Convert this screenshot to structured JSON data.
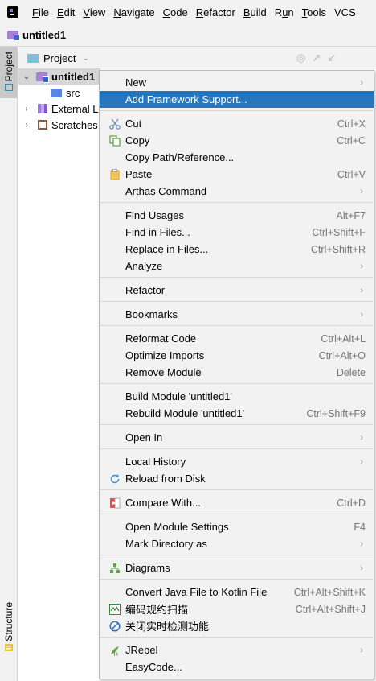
{
  "menubar": {
    "items": [
      {
        "pre": "",
        "ul": "F",
        "post": "ile"
      },
      {
        "pre": "",
        "ul": "E",
        "post": "dit"
      },
      {
        "pre": "",
        "ul": "V",
        "post": "iew"
      },
      {
        "pre": "",
        "ul": "N",
        "post": "avigate"
      },
      {
        "pre": "",
        "ul": "C",
        "post": "ode"
      },
      {
        "pre": "",
        "ul": "R",
        "post": "efactor"
      },
      {
        "pre": "",
        "ul": "B",
        "post": "uild"
      },
      {
        "pre": "R",
        "ul": "u",
        "post": "n"
      },
      {
        "pre": "",
        "ul": "T",
        "post": "ools"
      },
      {
        "pre": "",
        "ul": "",
        "post": "VCS"
      }
    ]
  },
  "navbar": {
    "project_name": "untitled1"
  },
  "tool_strip": {
    "project_tab": "Project",
    "structure_tab": "Structure"
  },
  "panel": {
    "header_title": "Project",
    "tree": {
      "root": "untitled1",
      "src": "src",
      "external_libs": "External Li",
      "scratches": "Scratches"
    }
  },
  "context_menu": {
    "items": [
      {
        "label": "New",
        "shortcut": "",
        "submenu": true
      },
      {
        "label": "Add Framework Support...",
        "shortcut": "",
        "submenu": false,
        "highlighted": true
      },
      {
        "label": "Cut",
        "shortcut": "Ctrl+X",
        "icon": "scissors-icon"
      },
      {
        "label": "Copy",
        "shortcut": "Ctrl+C",
        "icon": "copy-icon"
      },
      {
        "label": "Copy Path/Reference...",
        "shortcut": ""
      },
      {
        "label": "Paste",
        "shortcut": "Ctrl+V",
        "icon": "clipboard-icon"
      },
      {
        "label": "Arthas Command",
        "shortcut": "",
        "submenu": true
      },
      {
        "label": "Find Usages",
        "shortcut": "Alt+F7"
      },
      {
        "label": "Find in Files...",
        "shortcut": "Ctrl+Shift+F"
      },
      {
        "label": "Replace in Files...",
        "shortcut": "Ctrl+Shift+R"
      },
      {
        "label": "Analyze",
        "shortcut": "",
        "submenu": true
      },
      {
        "label": "Refactor",
        "shortcut": "",
        "submenu": true
      },
      {
        "label": "Bookmarks",
        "shortcut": "",
        "submenu": true
      },
      {
        "label": "Reformat Code",
        "shortcut": "Ctrl+Alt+L"
      },
      {
        "label": "Optimize Imports",
        "shortcut": "Ctrl+Alt+O"
      },
      {
        "label": "Remove Module",
        "shortcut": "Delete"
      },
      {
        "label": "Build Module 'untitled1'",
        "shortcut": ""
      },
      {
        "label": "Rebuild Module 'untitled1'",
        "shortcut": "Ctrl+Shift+F9"
      },
      {
        "label": "Open In",
        "shortcut": "",
        "submenu": true
      },
      {
        "label": "Local History",
        "shortcut": "",
        "submenu": true
      },
      {
        "label": "Reload from Disk",
        "shortcut": "",
        "icon": "reload-icon"
      },
      {
        "label": "Compare With...",
        "shortcut": "Ctrl+D",
        "icon": "compare-icon"
      },
      {
        "label": "Open Module Settings",
        "shortcut": "F4"
      },
      {
        "label": "Mark Directory as",
        "shortcut": "",
        "submenu": true
      },
      {
        "label": "Diagrams",
        "shortcut": "",
        "submenu": true,
        "icon": "diagram-icon"
      },
      {
        "label": "Convert Java File to Kotlin File",
        "shortcut": "Ctrl+Alt+Shift+K"
      },
      {
        "label": "编码规约扫描",
        "shortcut": "Ctrl+Alt+Shift+J",
        "icon": "scan-icon"
      },
      {
        "label": "关闭实时检测功能",
        "shortcut": "",
        "icon": "block-icon"
      },
      {
        "label": "JRebel",
        "shortcut": "",
        "submenu": true,
        "icon": "jrebel-icon"
      },
      {
        "label": "EasyCode...",
        "shortcut": ""
      }
    ]
  },
  "colors": {
    "highlight": "#2675bf",
    "background": "#f2f2f2"
  }
}
